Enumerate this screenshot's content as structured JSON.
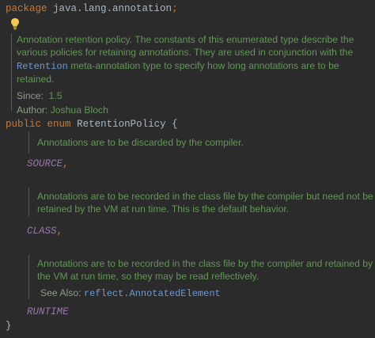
{
  "package_line": {
    "keyword": "package",
    "name": "java.lang.annotation",
    "semicolon": ";"
  },
  "class_doc": {
    "text_before_link": "Annotation retention policy. The constants of this enumerated type describe the various policies for retaining annotations. They are used in conjunction with the ",
    "link": "Retention",
    "text_after_link": " meta-annotation type to specify how long annotations are to be retained.",
    "since_label": "Since:",
    "since_value": "1.5",
    "author_label": "Author:",
    "author_value": "Joshua Bloch"
  },
  "declaration": {
    "modifier": "public",
    "keyword": "enum",
    "name": "RetentionPolicy",
    "open_brace": "{",
    "close_brace": "}"
  },
  "constants": [
    {
      "doc": "Annotations are to be discarded by the compiler.",
      "name": "SOURCE",
      "separator": ","
    },
    {
      "doc": "Annotations are to be recorded in the class file by the compiler but need not be retained by the VM at run time. This is the default behavior.",
      "name": "CLASS",
      "separator": ","
    },
    {
      "doc": "Annotations are to be recorded in the class file by the compiler and retained by the VM at run time, so they may be read reflectively.",
      "see_also_label": "See Also:",
      "see_also_link": "reflect.AnnotatedElement",
      "name": "RUNTIME",
      "separator": ""
    }
  ],
  "icons": {
    "intention_bulb": "lightbulb-icon"
  },
  "colors": {
    "background": "#2b2b2b",
    "keyword": "#cc7832",
    "identifier": "#a9b7c6",
    "enum_constant": "#9876aa",
    "doc_text": "#629755",
    "doc_link": "#6b9bd2",
    "bulb": "#f2c94c"
  }
}
